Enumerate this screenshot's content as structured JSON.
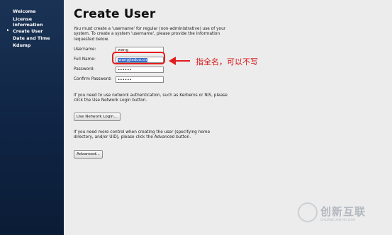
{
  "sidebar": {
    "items": [
      {
        "label": "Welcome"
      },
      {
        "label": "License"
      },
      {
        "label": "Information"
      },
      {
        "label": "Create User",
        "current": true
      },
      {
        "label": "Date and Time"
      },
      {
        "label": "Kdump"
      }
    ],
    "current_marker": "▸"
  },
  "page": {
    "title": "Create User",
    "intro": "You must create a 'username' for regular (non-administrative) use of your system.  To create a system 'username', please provide the information requested below.",
    "fields": {
      "username": {
        "label": "Username:",
        "value": "wang"
      },
      "fullname": {
        "label": "Full Name:",
        "value": "wangjiaduo.cn"
      },
      "password": {
        "label": "Password:",
        "value": "••••••"
      },
      "confirm": {
        "label": "Confirm Password:",
        "value": "••••••"
      }
    },
    "network_text": "If you need to use network authentication, such as Kerberos or NIS, please click the Use Network Login button.",
    "network_button": "Use Network Login...",
    "advanced_text": "If you need more control when creating the user (specifying home directory, and/or UID), please click the Advanced button.",
    "advanced_button": "Advanced..."
  },
  "annotation": {
    "note": "指全名，可以不写",
    "color": "#e21d1d"
  },
  "watermark": {
    "text": "创新互联",
    "sub": "CHUANG XIN HU LIAN"
  }
}
